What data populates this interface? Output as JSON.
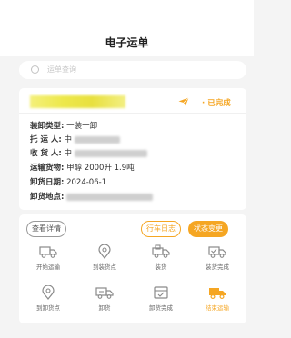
{
  "header": {
    "title": "电子运单"
  },
  "search": {
    "placeholder": "运单查询"
  },
  "order": {
    "status": "· 已完成",
    "fields": {
      "load_type_label": "装卸类型:",
      "load_type_value": "一装一卸",
      "shipper_label": "托 运 人:",
      "shipper_value": "中",
      "receiver_label": "收 货 人:",
      "receiver_value": "中",
      "goods_label": "运输货物:",
      "goods_value": "甲醇 2000升 1.9吨",
      "unload_date_label": "卸货日期:",
      "unload_date_value": "2024-06-1",
      "unload_place_label": "卸货地点:"
    }
  },
  "actions": {
    "detail_label": "查看详情",
    "log_label": "行车日志",
    "state_label": "状态变更",
    "items": [
      {
        "label": "开始运输",
        "icon": "truck-start-icon"
      },
      {
        "label": "到装货点",
        "icon": "location-pin-icon"
      },
      {
        "label": "装货",
        "icon": "truck-load-icon"
      },
      {
        "label": "装货完成",
        "icon": "truck-check-icon"
      },
      {
        "label": "到卸货点",
        "icon": "location-pin-icon"
      },
      {
        "label": "卸货",
        "icon": "truck-unload-icon"
      },
      {
        "label": "卸货完成",
        "icon": "box-check-icon"
      },
      {
        "label": "结束运输",
        "icon": "truck-end-icon"
      }
    ]
  },
  "colors": {
    "accent": "#f5a623",
    "icon": "#8a8a8a"
  }
}
